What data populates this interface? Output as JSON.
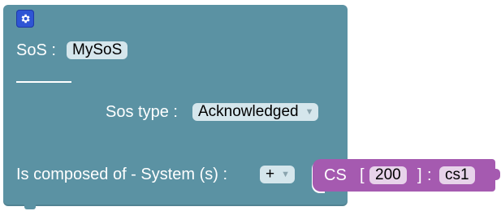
{
  "sos_block": {
    "gear_icon": "gear-icon",
    "name_label": "SoS :",
    "name_value": "MySoS",
    "type_label": "Sos type :",
    "type_value": "Acknowledged",
    "composed_label": "Is composed of - System (s) :",
    "composed_dropdown_value": "+",
    "block_color": "#5b92a3",
    "gear_color": "#2f55d4"
  },
  "cs_block": {
    "label": "CS",
    "open_bracket": "[",
    "id_value": "200",
    "close_bracket": "]",
    "separator": ":",
    "name_value": "cs1",
    "block_color": "#a55ab0"
  }
}
